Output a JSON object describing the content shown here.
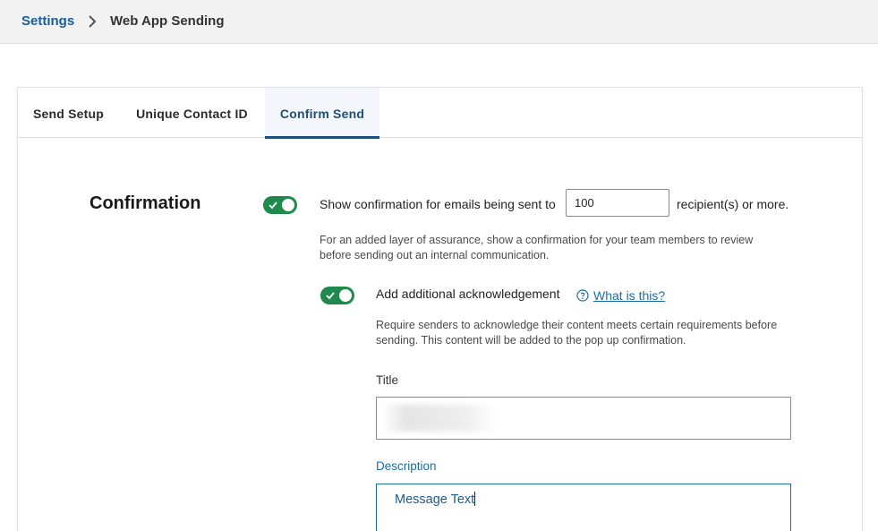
{
  "breadcrumb": {
    "parent": "Settings",
    "current": "Web App Sending"
  },
  "tabs": [
    {
      "label": "Send Setup"
    },
    {
      "label": "Unique Contact ID"
    },
    {
      "label": "Confirm Send",
      "active": true
    }
  ],
  "confirmation": {
    "section_title": "Confirmation",
    "toggle_on": true,
    "label_before": "Show confirmation for emails being sent to",
    "threshold_value": "100",
    "label_after": "recipient(s) or more.",
    "help_text": "For an added layer of assurance, show a confirmation for your team members to review before sending out an internal communication."
  },
  "acknowledgement": {
    "toggle_on": true,
    "label": "Add additional acknowledgement",
    "link_text": "What is this?",
    "help_text": "Require senders to acknowledge their content meets certain requirements before sending. This content will be added to the pop up confirmation."
  },
  "title_field": {
    "label": "Title",
    "value": ""
  },
  "description_field": {
    "label": "Description",
    "value": "Message Text"
  },
  "colors": {
    "accent": "#1d4f7c",
    "link": "#1a6ea8",
    "toggle_on": "#1f8a4c"
  },
  "icons": [
    "chevron-right-icon",
    "check-icon",
    "help-circle-icon"
  ]
}
